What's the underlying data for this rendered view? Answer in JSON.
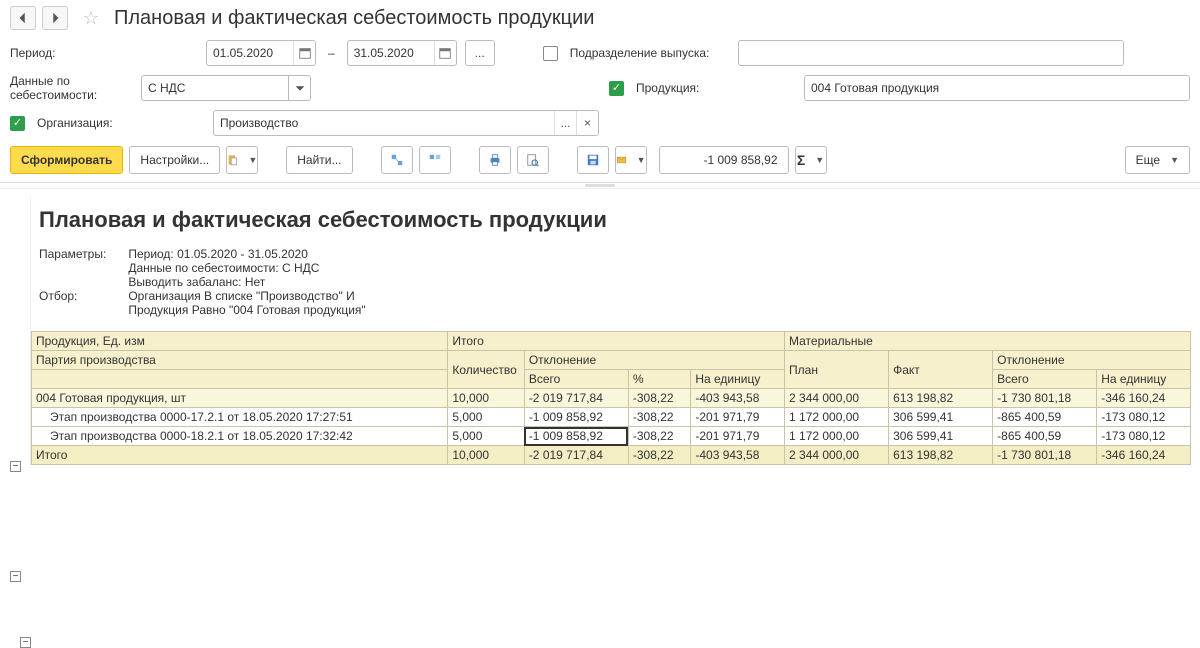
{
  "header": {
    "title": "Плановая и фактическая себестоимость продукции"
  },
  "filters": {
    "period_label": "Период:",
    "date_from": "01.05.2020",
    "date_to": "31.05.2020",
    "cost_label": "Данные по себестоимости:",
    "cost_value": "С НДС",
    "org_label": "Организация:",
    "org_value": "Производство",
    "dept_label": "Подразделение выпуска:",
    "prod_label": "Продукция:",
    "prod_value": "004 Готовая продукция"
  },
  "toolbar": {
    "generate": "Сформировать",
    "settings": "Настройки...",
    "find": "Найти...",
    "value": "-1 009 858,92",
    "more": "Еще"
  },
  "report": {
    "title": "Плановая и фактическая себестоимость продукции",
    "params_label": "Параметры:",
    "params_lines": [
      "Период: 01.05.2020 - 31.05.2020",
      "Данные по себестоимости: С НДС",
      "Выводить забаланс: Нет"
    ],
    "filter_label": "Отбор:",
    "filter_lines": [
      "Организация В списке \"Производство\" И",
      "Продукция Равно \"004 Готовая продукция\""
    ],
    "headers": {
      "product": "Продукция, Ед. изм",
      "batch": "Партия производства",
      "total_group": "Итого",
      "qty": "Количество",
      "deviation": "Отклонение",
      "total": "Всего",
      "pct": "%",
      "per_unit": "На единицу",
      "material_group": "Материальные",
      "plan": "План",
      "fact": "Факт"
    },
    "rows": [
      {
        "type": "group",
        "name": "004 Готовая продукция, шт",
        "qty": "10,000",
        "dev_total": "-2 019 717,84",
        "dev_pct": "-308,22",
        "dev_unit": "-403 943,58",
        "plan": "2 344 000,00",
        "fact": "613 198,82",
        "mdev_total": "-1 730 801,18",
        "mdev_unit": "-346 160,24"
      },
      {
        "type": "detail",
        "name": "Этап производства 0000-17.2.1 от 18.05.2020 17:27:51",
        "qty": "5,000",
        "dev_total": "-1 009 858,92",
        "dev_pct": "-308,22",
        "dev_unit": "-201 971,79",
        "plan": "1 172 000,00",
        "fact": "306 599,41",
        "mdev_total": "-865 400,59",
        "mdev_unit": "-173 080,12"
      },
      {
        "type": "detail",
        "name": "Этап производства 0000-18.2.1 от 18.05.2020 17:32:42",
        "qty": "5,000",
        "dev_total": "-1 009 858,92",
        "dev_pct": "-308,22",
        "dev_unit": "-201 971,79",
        "plan": "1 172 000,00",
        "fact": "306 599,41",
        "mdev_total": "-865 400,59",
        "mdev_unit": "-173 080,12"
      },
      {
        "type": "total",
        "name": "Итого",
        "qty": "10,000",
        "dev_total": "-2 019 717,84",
        "dev_pct": "-308,22",
        "dev_unit": "-403 943,58",
        "plan": "2 344 000,00",
        "fact": "613 198,82",
        "mdev_total": "-1 730 801,18",
        "mdev_unit": "-346 160,24"
      }
    ]
  }
}
